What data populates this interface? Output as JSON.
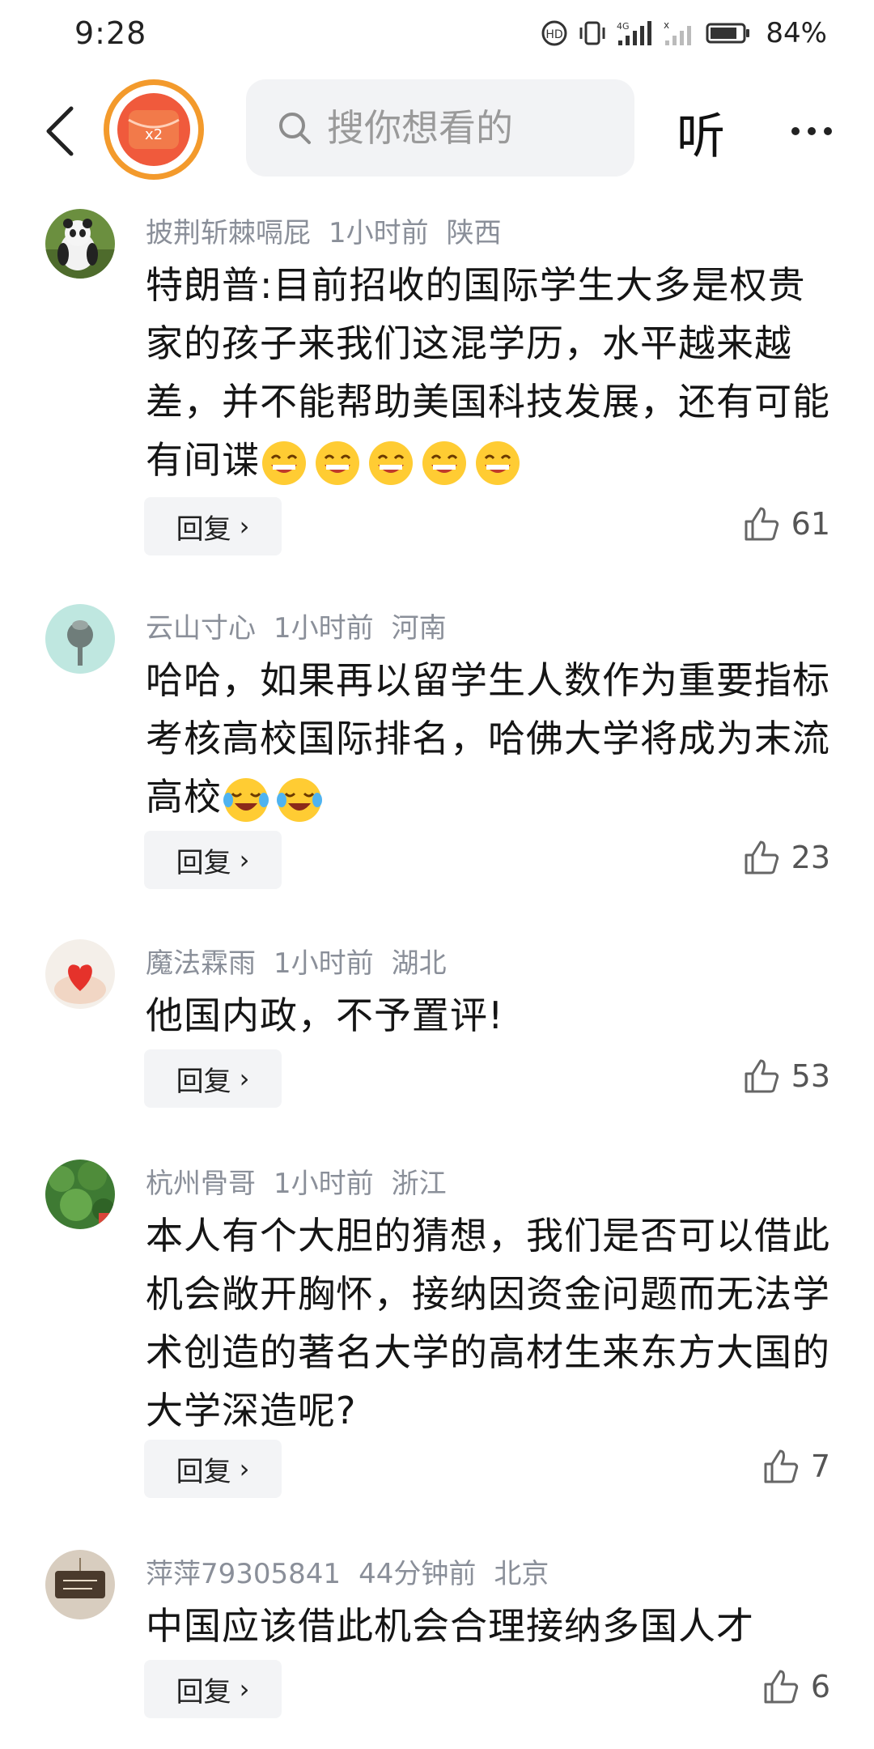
{
  "status_bar": {
    "time": "9:28",
    "battery": "84%",
    "icons": [
      "hd-call-icon",
      "vibrate-icon",
      "signal-4g-icon",
      "signal-icon",
      "battery-icon"
    ]
  },
  "top_bar": {
    "promo_label": "x2",
    "search_placeholder": "搜你想看的",
    "listen_label": "听"
  },
  "comments": [
    {
      "user": "披荆斩棘嗝屁",
      "time": "1小时前",
      "location": "陕西",
      "text": "特朗普:目前招收的国际学生大多是权贵家的孩子来我们这混学历，水平越来越差，并不能帮助美国科技发展，还有可能有间谍",
      "emojis": [
        "grin-emoji",
        "grin-emoji",
        "grin-emoji",
        "grin-emoji",
        "grin-emoji"
      ],
      "reply_label": "回复",
      "likes": "61"
    },
    {
      "user": "云山寸心",
      "time": "1小时前",
      "location": "河南",
      "text": "哈哈，如果再以留学生人数作为重要指标考核高校国际排名，哈佛大学将成为末流高校",
      "emojis": [
        "laugh-cry-emoji",
        "laugh-cry-emoji"
      ],
      "reply_label": "回复",
      "likes": "23"
    },
    {
      "user": "魔法霖雨",
      "time": "1小时前",
      "location": "湖北",
      "text": "他国内政，不予置评!",
      "emojis": [],
      "reply_label": "回复",
      "likes": "53"
    },
    {
      "user": "杭州骨哥",
      "time": "1小时前",
      "location": "浙江",
      "text": "本人有个大胆的猜想，我们是否可以借此机会敞开胸怀，接纳因资金问题而无法学术创造的著名大学的高材生来东方大国的大学深造呢?",
      "emojis": [],
      "reply_label": "回复",
      "likes": "7"
    },
    {
      "user": "萍萍79305841",
      "time": "44分钟前",
      "location": "北京",
      "text": "中国应该借此机会合理接纳多国人才",
      "emojis": [],
      "reply_label": "回复",
      "likes": "6"
    }
  ]
}
